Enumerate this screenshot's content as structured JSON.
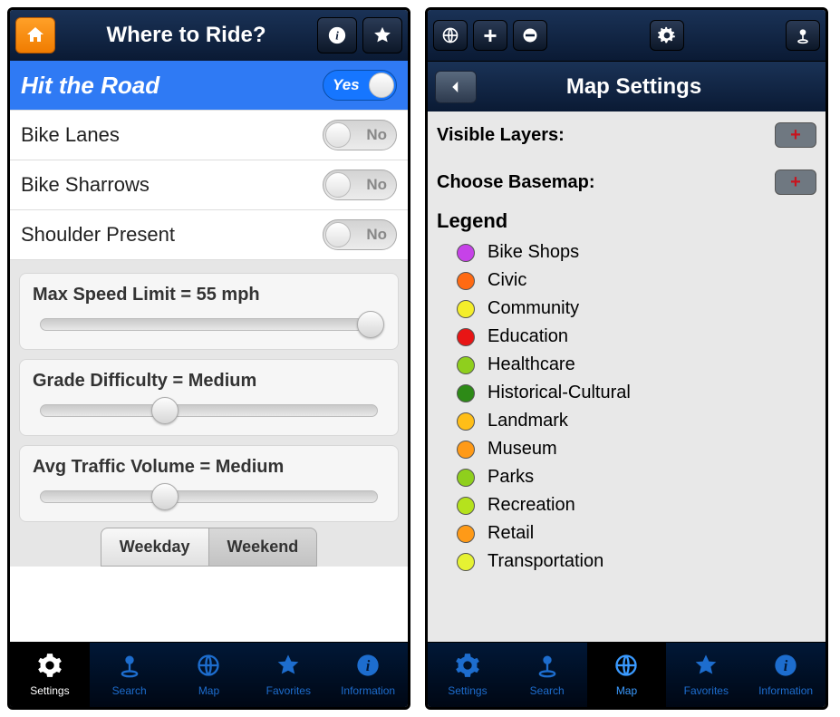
{
  "left": {
    "title": "Where to Ride?",
    "toggles": [
      {
        "label": "Hit the Road",
        "state": "on",
        "stateLabel": "Yes"
      },
      {
        "label": "Bike Lanes",
        "state": "off",
        "stateLabel": "No"
      },
      {
        "label": "Bike Sharrows",
        "state": "off",
        "stateLabel": "No"
      },
      {
        "label": "Shoulder Present",
        "state": "off",
        "stateLabel": "No"
      }
    ],
    "sliders": [
      {
        "label": "Max Speed Limit = 55 mph",
        "pos": 98
      },
      {
        "label": "Grade Difficulty = Medium",
        "pos": 37
      },
      {
        "label": "Avg Traffic Volume = Medium",
        "pos": 37
      }
    ],
    "segments": [
      {
        "label": "Weekday",
        "active": false
      },
      {
        "label": "Weekend",
        "active": true
      }
    ]
  },
  "right": {
    "subtitle": "Map Settings",
    "rows": [
      {
        "label": "Visible Layers:"
      },
      {
        "label": "Choose Basemap:"
      }
    ],
    "legendTitle": "Legend",
    "legend": [
      {
        "label": "Bike Shops",
        "color": "#c642e8"
      },
      {
        "label": "Civic",
        "color": "#ff6a13"
      },
      {
        "label": "Community",
        "color": "#f4ee2b"
      },
      {
        "label": "Education",
        "color": "#e81515"
      },
      {
        "label": "Healthcare",
        "color": "#8fcf1d"
      },
      {
        "label": "Historical-Cultural",
        "color": "#2d8a17"
      },
      {
        "label": "Landmark",
        "color": "#ffbe17"
      },
      {
        "label": "Museum",
        "color": "#ff9a17"
      },
      {
        "label": "Parks",
        "color": "#8fcf1d"
      },
      {
        "label": "Recreation",
        "color": "#b5e21d"
      },
      {
        "label": "Retail",
        "color": "#ff9a17"
      },
      {
        "label": "Transportation",
        "color": "#e6f233"
      }
    ]
  },
  "tabs": [
    {
      "label": "Settings",
      "icon": "gear"
    },
    {
      "label": "Search",
      "icon": "joy"
    },
    {
      "label": "Map",
      "icon": "globe"
    },
    {
      "label": "Favorites",
      "icon": "star"
    },
    {
      "label": "Information",
      "icon": "info"
    }
  ],
  "activeTabLeft": 0,
  "activeTabRight": 2
}
